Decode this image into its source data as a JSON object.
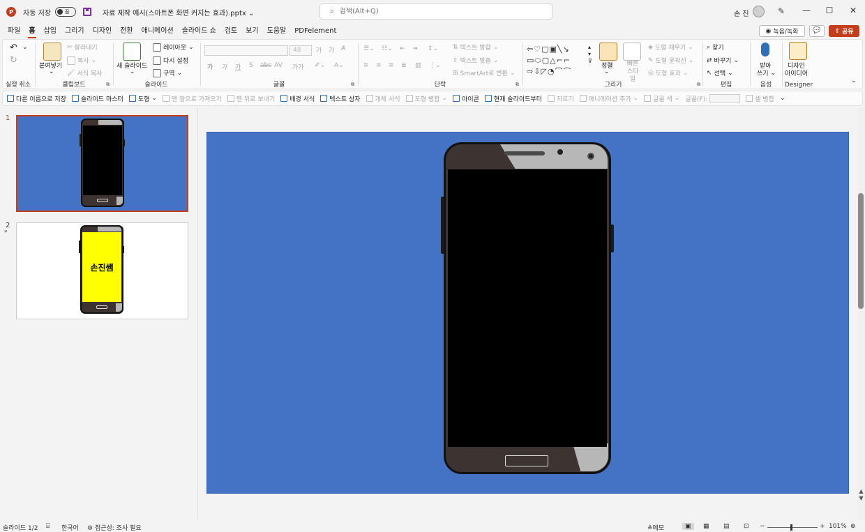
{
  "titlebar": {
    "app_logo_letter": "P",
    "autosave_label": "자동 저장",
    "autosave_state": "끔",
    "document_title": "자료 제작 예시(스마트폰 화면 커지는 효과).pptx",
    "title_dropdown": "⌄",
    "search_placeholder": "검색(Alt+Q)",
    "user_name": "손 진",
    "minimize": "—",
    "maximize": "☐",
    "close": "✕"
  },
  "menu": {
    "tabs": [
      "파일",
      "홈",
      "삽입",
      "그리기",
      "디자인",
      "전환",
      "애니메이션",
      "슬라이드 쇼",
      "검토",
      "보기",
      "도움말",
      "PDFelement"
    ],
    "record_label": "녹음/녹화",
    "share_label": "공유",
    "comment_icon": "💬"
  },
  "ribbon": {
    "undo_group": "실행 취소",
    "clipboard": {
      "label": "클립보드",
      "paste": "붙여넣기",
      "cut": "잘라내기",
      "copy": "복사",
      "format_painter": "서식 복사"
    },
    "slides": {
      "label": "슬라이드",
      "new_slide": "새 슬라이드",
      "layout": "레이아웃",
      "reset": "다시 설정",
      "section": "구역"
    },
    "font": {
      "label": "글꼴",
      "size": "48",
      "bold": "가",
      "italic": "가",
      "underline": "가",
      "shadow": "S",
      "strike": "abc",
      "spacing": "AV",
      "case": "가가",
      "grow": "가",
      "shrink": "가"
    },
    "paragraph": {
      "label": "단락",
      "text_direction": "텍스트 방향",
      "align_text": "텍스트 맞춤",
      "smartart": "SmartArt로 변환"
    },
    "drawing": {
      "label": "그리기",
      "arrange": "정렬",
      "quick_styles": "빠른 스타일",
      "shape_fill": "도형 채우기",
      "shape_outline": "도형 윤곽선",
      "shape_effects": "도형 효과"
    },
    "editing": {
      "label": "편집",
      "find": "찾기",
      "replace": "바꾸기",
      "select": "선택"
    },
    "voice": {
      "label": "음성",
      "dictate_line1": "받아",
      "dictate_line2": "쓰기"
    },
    "designer": {
      "label": "Designer",
      "ideas_line1": "디자인",
      "ideas_line2": "아이디어"
    }
  },
  "quick_access": {
    "items": [
      {
        "label": "다른 이름으로 저장",
        "disabled": false
      },
      {
        "label": "슬라이드 마스터",
        "disabled": false
      },
      {
        "label": "도형",
        "disabled": false
      },
      {
        "label": "맨 앞으로 가져오기",
        "disabled": true
      },
      {
        "label": "맨 뒤로 보내기",
        "disabled": true
      },
      {
        "label": "배경 서식",
        "disabled": false
      },
      {
        "label": "텍스트 상자",
        "disabled": false
      },
      {
        "label": "개체 서식",
        "disabled": true
      },
      {
        "label": "도형 병합",
        "disabled": true
      },
      {
        "label": "아이콘",
        "disabled": false
      },
      {
        "label": "현재 슬라이드부터",
        "disabled": false
      },
      {
        "label": "자르기",
        "disabled": true
      },
      {
        "label": "애니메이션 추가",
        "disabled": true
      },
      {
        "label": "글꼴 색",
        "disabled": true
      },
      {
        "label": "글꼴(F):",
        "disabled": true
      },
      {
        "label": "셀 병합",
        "disabled": true
      }
    ]
  },
  "thumbnails": [
    {
      "number": "1",
      "selected": true,
      "background": "#4472c4",
      "screen_color": "#000000",
      "screen_text": ""
    },
    {
      "number": "2",
      "selected": false,
      "background": "#ffffff",
      "screen_color": "#ffff00",
      "screen_text": "손진쌤",
      "star": "*"
    }
  ],
  "statusbar": {
    "slide_indicator": "슬라이드 1/2",
    "language": "한국어",
    "accessibility": "접근성: 조사 필요",
    "notes": "메모",
    "zoom": "101%"
  },
  "colors": {
    "accent": "#c43e1c",
    "slide_background": "#4472c4",
    "phone_body": "#3d3331",
    "phone_shine": "#b7b7b7"
  }
}
